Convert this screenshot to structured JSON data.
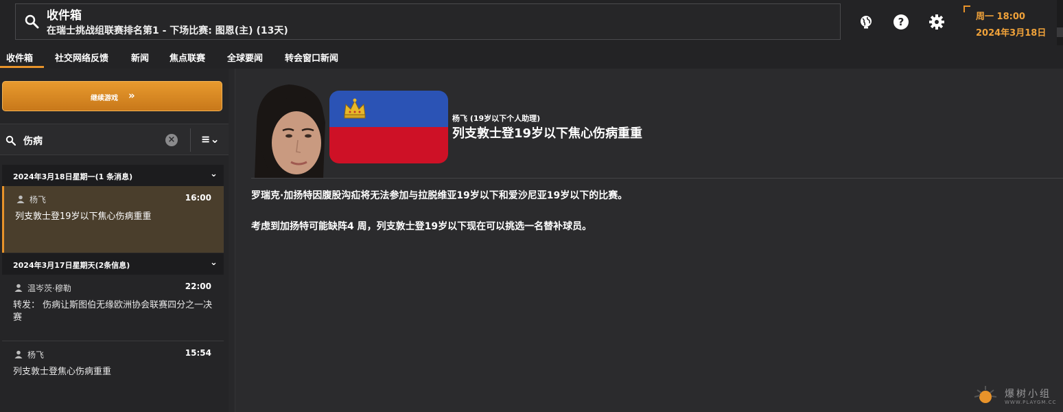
{
  "header": {
    "title": "收件箱",
    "subtitle": "在瑞士挑战组联赛排名第1 - 下场比赛: 图恩(主) (13天)",
    "time": "周一 18:00",
    "date": "2024年3月18日"
  },
  "tabs": [
    "收件箱",
    "社交网络反馈",
    "新闻",
    "焦点联赛",
    "全球要闻",
    "转会窗口新闻"
  ],
  "sidebar": {
    "continue_label": "继续游戏",
    "search_value": "伤病",
    "groups": [
      {
        "label": "2024年3月18日星期一(1 条消息)",
        "messages": [
          {
            "sender": "杨飞",
            "time": "16:00",
            "subject": "列支敦士登19岁以下焦心伤病重重"
          }
        ]
      },
      {
        "label": "2024年3月17日星期天(2条信息)",
        "messages": [
          {
            "sender": "温岑茨·穆勒",
            "time": "22:00",
            "subject": "转发： 伤病让斯图伯无缘欧洲协会联赛四分之一决赛"
          },
          {
            "sender": "杨飞",
            "time": "15:54",
            "subject": "列支敦士登焦心伤病重重"
          }
        ]
      }
    ]
  },
  "article": {
    "author": "杨飞 (19岁以下个人助理)",
    "headline": "列支敦士登19岁以下焦心伤病重重",
    "paragraphs": [
      "罗瑞克·加扬特因腹股沟疝将无法参加与拉脱维亚19岁以下和爱沙尼亚19岁以下的比赛。",
      "考虑到加扬特可能缺阵4 周，列支敦士登19岁以下现在可以挑选一名替补球员。"
    ]
  },
  "watermark": {
    "text": "爆树小组",
    "url": "WWW.PLAYGM.CC"
  },
  "colors": {
    "accent": "#e8932a",
    "flag_blue": "#2b53b5",
    "flag_red": "#ce1126"
  }
}
